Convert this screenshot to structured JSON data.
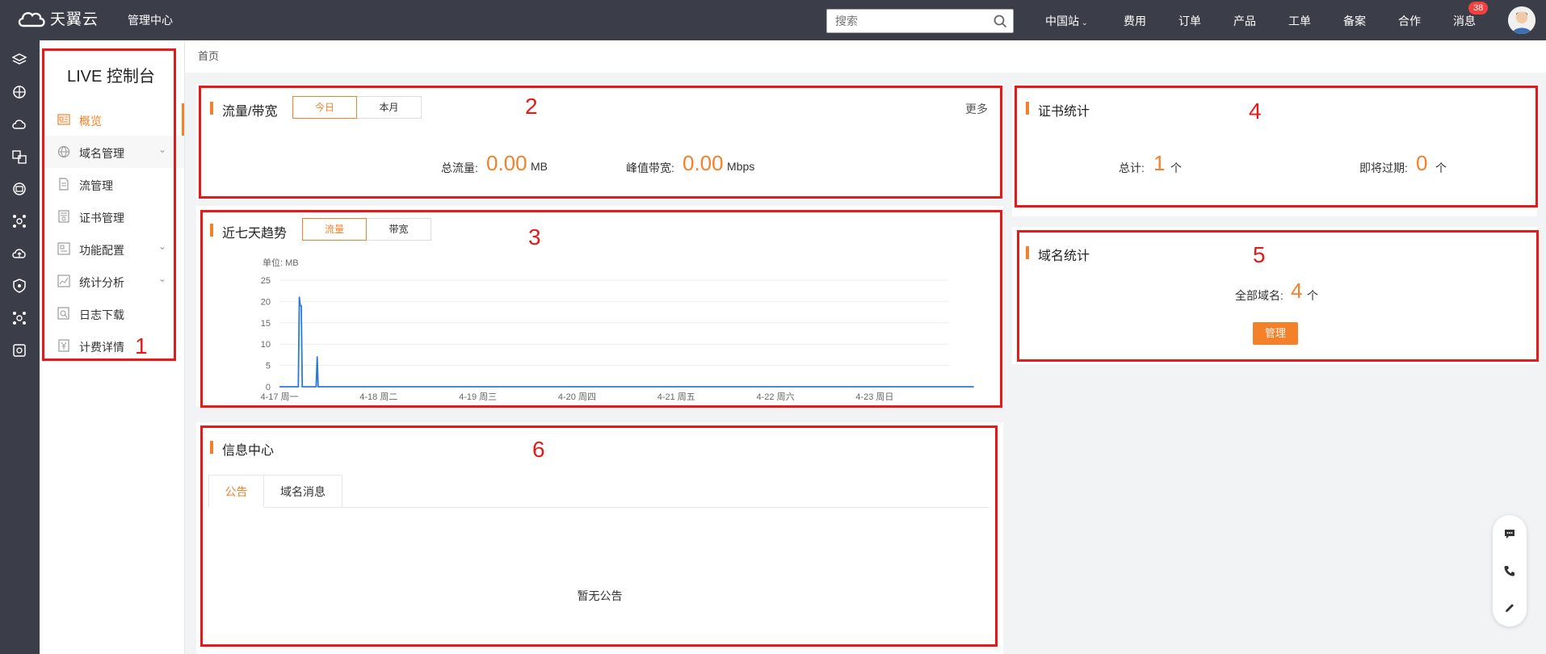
{
  "topbar": {
    "logo_text": "天翼云",
    "mgmt_label": "管理中心",
    "search_placeholder": "搜索",
    "nav": [
      "中国站",
      "费用",
      "订单",
      "产品",
      "工单",
      "备案",
      "合作",
      "消息"
    ],
    "message_count": "38"
  },
  "rail": {
    "icons": [
      "layers-icon",
      "globe-grid-icon",
      "cloud-icon",
      "translate-icon",
      "database-icon",
      "network-icon",
      "cloud-upload-icon",
      "shield-icon",
      "cluster-icon",
      "monitor-icon"
    ]
  },
  "sidebar": {
    "title": "LIVE 控制台",
    "items": [
      {
        "label": "概览",
        "icon": "overview-icon",
        "active": true
      },
      {
        "label": "域名管理",
        "icon": "globe-icon",
        "expandable": true
      },
      {
        "label": "流管理",
        "icon": "document-icon"
      },
      {
        "label": "证书管理",
        "icon": "certificate-icon"
      },
      {
        "label": "功能配置",
        "icon": "config-icon",
        "expandable": true
      },
      {
        "label": "统计分析",
        "icon": "chart-icon",
        "expandable": true
      },
      {
        "label": "日志下载",
        "icon": "log-icon"
      },
      {
        "label": "计费详情",
        "icon": "yen-icon"
      }
    ]
  },
  "breadcrumb": "首页",
  "traffic": {
    "title": "流量/带宽",
    "tabs": [
      "今日",
      "本月"
    ],
    "more": "更多",
    "total_label": "总流量:",
    "total_value": "0.00",
    "total_unit": "MB",
    "peak_label": "峰值带宽:",
    "peak_value": "0.00",
    "peak_unit": "Mbps"
  },
  "trend": {
    "title": "近七天趋势",
    "tabs": [
      "流量",
      "带宽"
    ]
  },
  "chart_data": {
    "type": "line",
    "ylabel": "单位: MB",
    "ylim": [
      0,
      25
    ],
    "yticks": [
      0,
      5,
      10,
      15,
      20,
      25
    ],
    "x_ticks": [
      "4-17 周一",
      "4-18 周二",
      "4-19 周三",
      "4-20 周四",
      "4-21 周五",
      "4-22 周六",
      "4-23 周日"
    ],
    "series": [
      {
        "color": "#2b7bd6",
        "x": [
          0,
          0.19,
          0.2,
          0.21,
          0.22,
          0.23,
          0.24,
          0.37,
          0.38,
          0.39,
          0.4,
          7
        ],
        "values": [
          0,
          0,
          21,
          19,
          19,
          0,
          0,
          0,
          7,
          0,
          0,
          0
        ]
      }
    ]
  },
  "cert": {
    "title": "证书统计",
    "total_label": "总计:",
    "total_value": "1",
    "total_unit": "个",
    "expiring_label": "即将过期:",
    "expiring_value": "0",
    "expiring_unit": "个"
  },
  "domain": {
    "title": "域名统计",
    "all_label": "全部域名:",
    "all_value": "4",
    "all_unit": "个",
    "manage_button": "管理"
  },
  "info": {
    "title": "信息中心",
    "tabs": [
      "公告",
      "域名消息"
    ],
    "empty": "暂无公告"
  },
  "annotations": [
    "1",
    "2",
    "3",
    "4",
    "5",
    "6"
  ],
  "colors": {
    "accent": "#f5802a",
    "topbar": "#3b3d49",
    "annotation": "#e31b1b",
    "line": "#2b7bd6"
  }
}
